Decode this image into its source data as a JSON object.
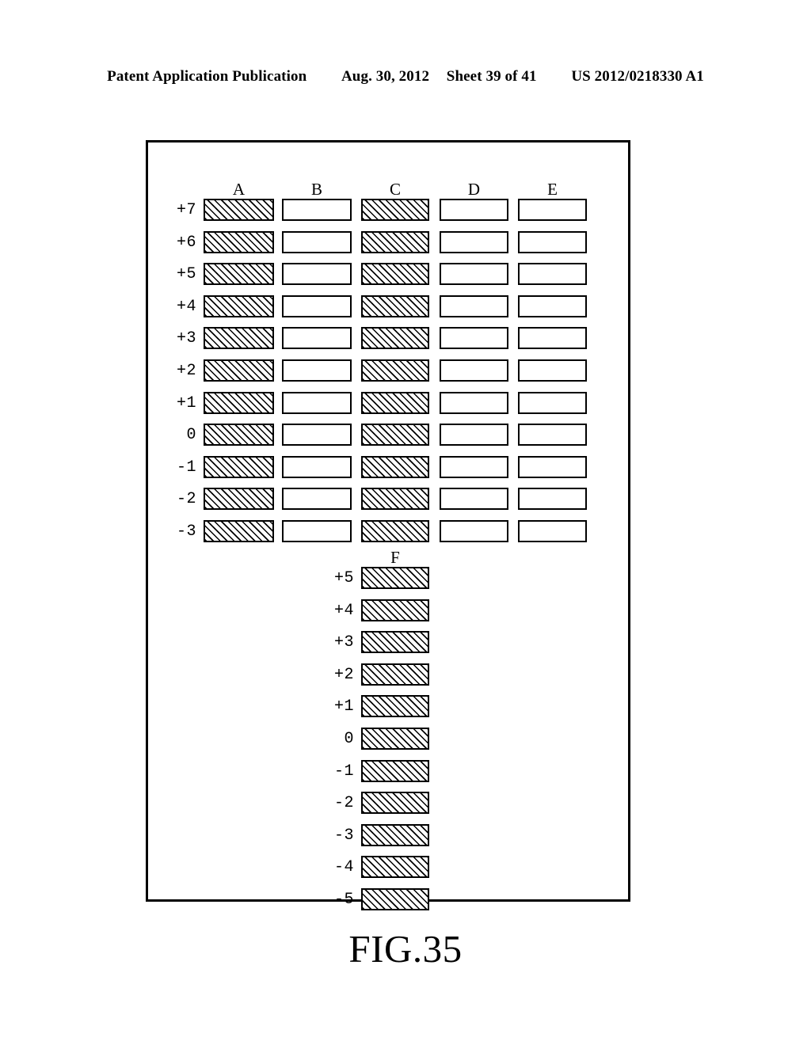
{
  "header": {
    "publication": "Patent Application Publication",
    "date": "Aug. 30, 2012",
    "sheet": "Sheet 39 of 41",
    "doc_number": "US 2012/0218330 A1"
  },
  "figure": {
    "caption": "FIG.35",
    "colors": {
      "line": "#000000",
      "background": "#ffffff"
    },
    "upper_table": {
      "column_headers": [
        "A",
        "B",
        "C",
        "D",
        "E"
      ],
      "row_labels": [
        "+7",
        "+6",
        "+5",
        "+4",
        "+3",
        "+2",
        "+1",
        "0",
        "-1",
        "-2",
        "-3"
      ],
      "hatched_columns": [
        "A",
        "C"
      ],
      "empty_columns": [
        "B",
        "D",
        "E"
      ]
    },
    "lower_table": {
      "column_headers": [
        "F"
      ],
      "row_labels": [
        "+5",
        "+4",
        "+3",
        "+2",
        "+1",
        "0",
        "-1",
        "-2",
        "-3",
        "-4",
        "-5"
      ],
      "hatched_columns": [
        "F"
      ],
      "empty_columns": []
    }
  },
  "chart_data": {
    "type": "bar",
    "title": "FIG.35",
    "xlabel": "",
    "ylabel": "",
    "note": "Patent figure: two stacked grids of rectangular cells; hatched cells indicate active/filled state, open cells indicate inactive/empty state.",
    "panels": [
      {
        "name": "upper",
        "categories": [
          "A",
          "B",
          "C",
          "D",
          "E"
        ],
        "rows": [
          "+7",
          "+6",
          "+5",
          "+4",
          "+3",
          "+2",
          "+1",
          "0",
          "-1",
          "-2",
          "-3"
        ],
        "cells": [
          {
            "row": "+7",
            "A": "hatched",
            "B": "empty",
            "C": "hatched",
            "D": "empty",
            "E": "empty"
          },
          {
            "row": "+6",
            "A": "hatched",
            "B": "empty",
            "C": "hatched",
            "D": "empty",
            "E": "empty"
          },
          {
            "row": "+5",
            "A": "hatched",
            "B": "empty",
            "C": "hatched",
            "D": "empty",
            "E": "empty"
          },
          {
            "row": "+4",
            "A": "hatched",
            "B": "empty",
            "C": "hatched",
            "D": "empty",
            "E": "empty"
          },
          {
            "row": "+3",
            "A": "hatched",
            "B": "empty",
            "C": "hatched",
            "D": "empty",
            "E": "empty"
          },
          {
            "row": "+2",
            "A": "hatched",
            "B": "empty",
            "C": "hatched",
            "D": "empty",
            "E": "empty"
          },
          {
            "row": "+1",
            "A": "hatched",
            "B": "empty",
            "C": "hatched",
            "D": "empty",
            "E": "empty"
          },
          {
            "row": "0",
            "A": "hatched",
            "B": "empty",
            "C": "hatched",
            "D": "empty",
            "E": "empty"
          },
          {
            "row": "-1",
            "A": "hatched",
            "B": "empty",
            "C": "hatched",
            "D": "empty",
            "E": "empty"
          },
          {
            "row": "-2",
            "A": "hatched",
            "B": "empty",
            "C": "hatched",
            "D": "empty",
            "E": "empty"
          },
          {
            "row": "-3",
            "A": "hatched",
            "B": "empty",
            "C": "hatched",
            "D": "empty",
            "E": "empty"
          }
        ]
      },
      {
        "name": "lower",
        "categories": [
          "F"
        ],
        "rows": [
          "+5",
          "+4",
          "+3",
          "+2",
          "+1",
          "0",
          "-1",
          "-2",
          "-3",
          "-4",
          "-5"
        ],
        "cells": [
          {
            "row": "+5",
            "F": "hatched"
          },
          {
            "row": "+4",
            "F": "hatched"
          },
          {
            "row": "+3",
            "F": "hatched"
          },
          {
            "row": "+2",
            "F": "hatched"
          },
          {
            "row": "+1",
            "F": "hatched"
          },
          {
            "row": "0",
            "F": "hatched"
          },
          {
            "row": "-1",
            "F": "hatched"
          },
          {
            "row": "-2",
            "F": "hatched"
          },
          {
            "row": "-3",
            "F": "hatched"
          },
          {
            "row": "-4",
            "F": "hatched"
          },
          {
            "row": "-5",
            "F": "hatched"
          }
        ]
      }
    ]
  }
}
